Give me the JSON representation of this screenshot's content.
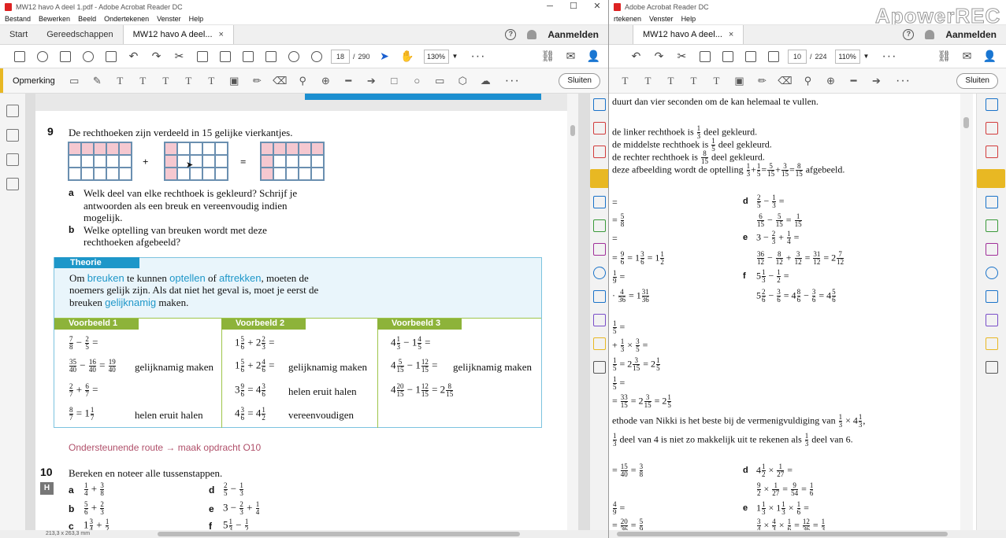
{
  "left": {
    "title": "MW12 havo A deel 1.pdf - Adobe Acrobat Reader DC",
    "menu": [
      "Bestand",
      "Bewerken",
      "Beeld",
      "Ondertekenen",
      "Venster",
      "Help"
    ],
    "tabs": {
      "start": "Start",
      "tools": "Gereedschappen",
      "doc": "MW12 havo A deel...",
      "close": "×"
    },
    "signin": "Aanmelden",
    "page": {
      "current": "18",
      "sep": "/",
      "total": "290"
    },
    "zoom": "130%",
    "annotate_label": "Opmerking",
    "close_button": "Sluiten",
    "status": "213,3 x 263,3 mm",
    "ex9": {
      "num": "9",
      "intro": "De rechthoeken zijn verdeeld in 15 gelijke vierkantjes.",
      "plus": "+",
      "eq": "=",
      "a_label": "a",
      "a1": "Welk deel van elke rechthoek is gekleurd? Schrijf je",
      "a2": "antwoorden als een breuk en vereenvoudig indien",
      "a3": "mogelijk.",
      "b_label": "b",
      "b1": "Welke optelling van breuken wordt met deze",
      "b2": "rechthoeken afgebeeld?"
    },
    "theorie": {
      "header": "Theorie",
      "l1a": "Om ",
      "l1b": "breuken",
      "l1c": " te kunnen ",
      "l1d": "optellen",
      "l1e": " of ",
      "l1f": "aftrekken",
      "l1g": ", moeten de",
      "l2": "noemers gelijk zijn. Als dat niet het geval is, moet je eerst de",
      "l3a": "breuken ",
      "l3b": "gelijknamig",
      "l3c": " maken.",
      "vb1": "Voorbeeld 1",
      "vb2": "Voorbeeld 2",
      "vb3": "Voorbeeld 3",
      "gelijknamig": "gelijknamig maken",
      "eruit": "helen eruit halen",
      "vereenvoudigen": "vereenvoudigen"
    },
    "route": "Ondersteunende route → maak opdracht O10",
    "ex10": {
      "num": "10",
      "intro": "Bereken en noteer alle tussenstappen.",
      "h": "H",
      "a": "a",
      "b": "b",
      "c": "c",
      "d": "d",
      "e": "e",
      "f": "f"
    }
  },
  "right": {
    "title": "Adobe Acrobat Reader DC",
    "menu": [
      "rtekenen",
      "Venster",
      "Help"
    ],
    "tab": "MW12 havo A deel...",
    "signin": "Aanmelden",
    "page": {
      "current": "10",
      "sep": "/",
      "total": "224"
    },
    "zoom": "110%",
    "close_button": "Sluiten",
    "watermark": "ApowerREC",
    "lines": {
      "l1": "duurt dan vier seconden om de kan helemaal te vullen.",
      "l2a": "de linker rechthoek is ",
      "l2b": " deel gekleurd.",
      "l3a": "de middelste rechthoek is ",
      "l3b": " deel gekleurd.",
      "l4a": "de rechter rechthoek is ",
      "l4b": " deel gekleurd.",
      "l5a": "deze afbeelding wordt de optelling ",
      "l5b": " afgebeeld.",
      "d": "d",
      "e": "e",
      "f": "f",
      "nikki1": "ethode van Nikki is het beste bij de vermenigvuldiging van",
      "nikki2": "deel van 4 is niet zo makkelijk uit te rekenen als",
      "nikki2b": "deel van 6."
    }
  }
}
